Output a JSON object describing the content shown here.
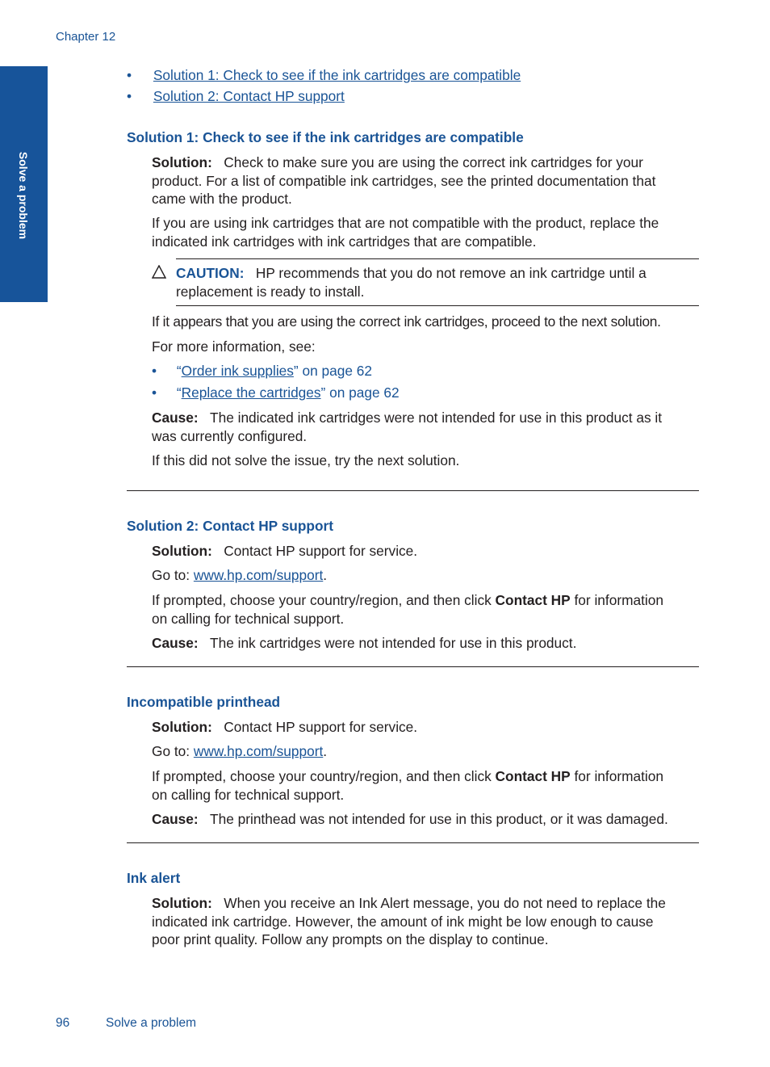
{
  "header": {
    "chapter": "Chapter 12"
  },
  "side_tab": {
    "label": "Solve a problem"
  },
  "toc_links": [
    "Solution 1: Check to see if the ink cartridges are compatible",
    "Solution 2: Contact HP support"
  ],
  "section1": {
    "heading": "Solution 1: Check to see if the ink cartridges are compatible",
    "solution_label": "Solution:",
    "solution_text_l1": "Check to make sure you are using the correct ink cartridges for your",
    "solution_text_l2": "product. For a list of compatible ink cartridges, see the printed documentation that",
    "solution_text_l3": "came with the product.",
    "para2_l1": "If you are using ink cartridges that are not compatible with the product, replace the",
    "para2_l2": "indicated ink cartridges with ink cartridges that are compatible.",
    "caution_label": "CAUTION:",
    "caution_l1": "HP recommends that you do not remove an ink cartridge until a",
    "caution_l2": "replacement is ready to install.",
    "para3": "If it appears that you are using the correct ink cartridges, proceed to the next solution.",
    "more_info": "For more information, see:",
    "refs": [
      {
        "open": "“",
        "link": "Order ink supplies",
        "rest": "” on page 62"
      },
      {
        "open": "“",
        "link": "Replace the cartridges",
        "rest": "” on page 62"
      }
    ],
    "cause_label": "Cause:",
    "cause_l1": "The indicated ink cartridges were not intended for use in this product as it",
    "cause_l2": "was currently configured.",
    "next": "If this did not solve the issue, try the next solution."
  },
  "section2": {
    "heading": "Solution 2: Contact HP support",
    "solution_label": "Solution:",
    "solution_text": "Contact HP support for service.",
    "goto_prefix": "Go to: ",
    "goto_link": "www.hp.com/support",
    "goto_suffix": ".",
    "prompt_a": "If prompted, choose your country/region, and then click ",
    "prompt_bold": "Contact HP",
    "prompt_b": " for information",
    "prompt_l2": "on calling for technical support.",
    "cause_label": "Cause:",
    "cause_text": "The ink cartridges were not intended for use in this product."
  },
  "section3": {
    "heading": "Incompatible printhead",
    "solution_label": "Solution:",
    "solution_text": "Contact HP support for service.",
    "goto_prefix": "Go to: ",
    "goto_link": "www.hp.com/support",
    "goto_suffix": ".",
    "prompt_a": "If prompted, choose your country/region, and then click ",
    "prompt_bold": "Contact HP",
    "prompt_b": " for information",
    "prompt_l2": "on calling for technical support.",
    "cause_label": "Cause:",
    "cause_text": "The printhead was not intended for use in this product, or it was damaged."
  },
  "section4": {
    "heading": "Ink alert",
    "solution_label": "Solution:",
    "l1": "When you receive an Ink Alert message, you do not need to replace the",
    "l2": "indicated ink cartridge. However, the amount of ink might be low enough to cause",
    "l3": "poor print quality. Follow any prompts on the display to continue."
  },
  "footer": {
    "page_number": "96",
    "title": "Solve a problem"
  },
  "colors": {
    "accent": "#1a5496",
    "side_tab": "#17549a",
    "text": "#231f20"
  }
}
